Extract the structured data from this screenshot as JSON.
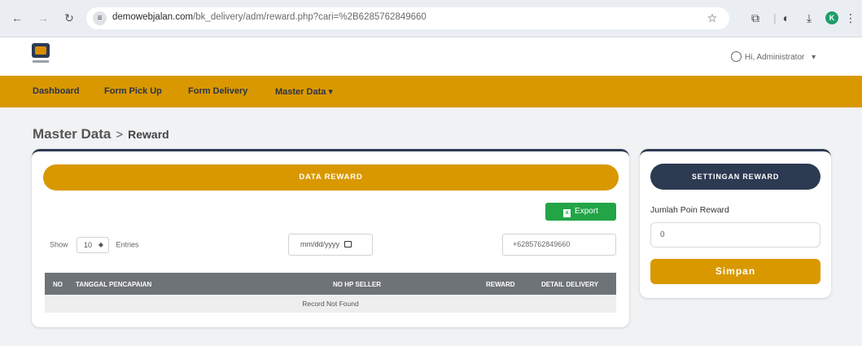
{
  "browser": {
    "url_host": "demowebjalan.com",
    "url_path": "/bk_delivery/adm/reward.php?cari=%2B6285762849660",
    "profile_initial": "K"
  },
  "header": {
    "user_label": "Hi, Administrator",
    "user_caret": "▾"
  },
  "nav": {
    "items": [
      "Dashboard",
      "Form Pick Up",
      "Form Delivery",
      "Master Data"
    ],
    "dropdown_caret": "▾"
  },
  "breadcrumb": {
    "section": "Master Data",
    "separator": ">",
    "current": "Reward"
  },
  "main_card": {
    "title": "DATA REWARD",
    "export_label": "Export",
    "show_label": "Show",
    "entries_value": "10",
    "entries_label": "Entries",
    "date_placeholder": "mm/dd/yyyy",
    "search_value": "+6285762849660",
    "table": {
      "columns": [
        "NO",
        "TANGGAL PENCAPAIAN",
        "NO HP SELLER",
        "REWARD",
        "DETAIL DELIVERY"
      ],
      "empty_message": "Record Not Found"
    }
  },
  "side_card": {
    "title": "SETTINGAN REWARD",
    "field_label": "Jumlah Poin Reward",
    "field_value": "0",
    "save_label": "Simpan"
  },
  "colors": {
    "accent": "#d99800",
    "dark": "#2c3a52",
    "export_green": "#22a447",
    "table_header": "#6e7378"
  },
  "icons": [
    "back-icon",
    "forward-icon",
    "reload-icon",
    "site-info-icon",
    "star-icon",
    "extensions-icon",
    "sidebar-icon",
    "download-icon",
    "menu-icon",
    "user-icon",
    "excel-icon",
    "calendar-icon",
    "sort-arrows-icon"
  ]
}
